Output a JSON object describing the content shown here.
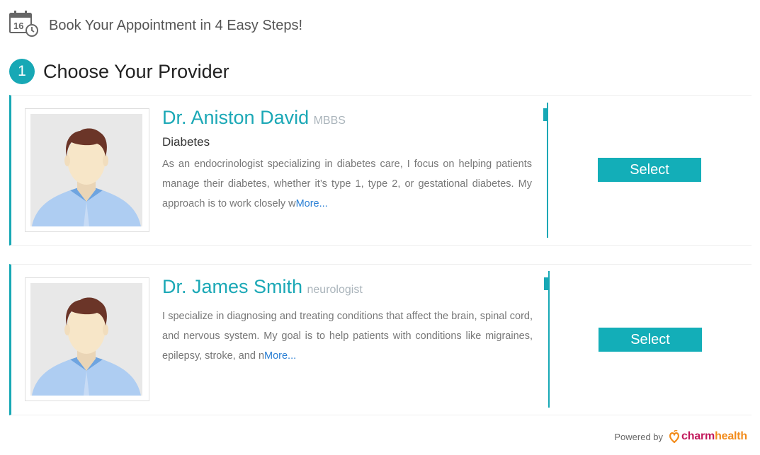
{
  "header": {
    "title": "Book Your Appointment in 4 Easy Steps!",
    "icon": "calendar-clock-icon",
    "calendar_day": "16"
  },
  "step": {
    "number": "1",
    "title": "Choose Your Provider"
  },
  "providers": [
    {
      "name": "Dr. Aniston David",
      "qualification": "MBBS",
      "specialty": "Diabetes",
      "bio": "As an endocrinologist specializing in diabetes care, I focus on helping patients manage their diabetes, whether it’s type 1, type 2, or gestational diabetes. My approach is to work closely w",
      "more_label": "More...",
      "select_label": "Select"
    },
    {
      "name": "Dr. James Smith",
      "qualification": "neurologist",
      "specialty": "",
      "bio": "I specialize in diagnosing and treating conditions that affect the brain, spinal cord, and nervous system. My goal is to help patients with conditions like migraines, epilepsy, stroke, and n",
      "more_label": "More...",
      "select_label": "Select"
    }
  ],
  "footer": {
    "powered_by": "Powered by",
    "brand_part1": "charm",
    "brand_part2": "health"
  },
  "colors": {
    "accent": "#17a8b5",
    "button": "#13aeb8",
    "link": "#2a7fd4",
    "brand_magenta": "#c2185b",
    "brand_orange": "#f28c1c"
  }
}
